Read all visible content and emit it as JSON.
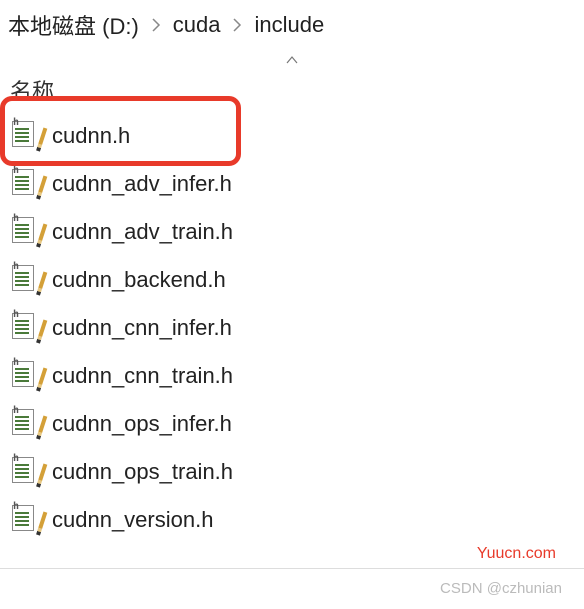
{
  "breadcrumb": {
    "items": [
      {
        "label": "本地磁盘 (D:)"
      },
      {
        "label": "cuda"
      },
      {
        "label": "include"
      }
    ]
  },
  "column_header": "名称",
  "files": [
    {
      "name": "cudnn.h",
      "highlighted": true
    },
    {
      "name": "cudnn_adv_infer.h"
    },
    {
      "name": "cudnn_adv_train.h"
    },
    {
      "name": "cudnn_backend.h"
    },
    {
      "name": "cudnn_cnn_infer.h"
    },
    {
      "name": "cudnn_cnn_train.h"
    },
    {
      "name": "cudnn_ops_infer.h"
    },
    {
      "name": "cudnn_ops_train.h"
    },
    {
      "name": "cudnn_version.h"
    }
  ],
  "watermark1": "Yuucn.com",
  "watermark2": "CSDN @czhunian"
}
